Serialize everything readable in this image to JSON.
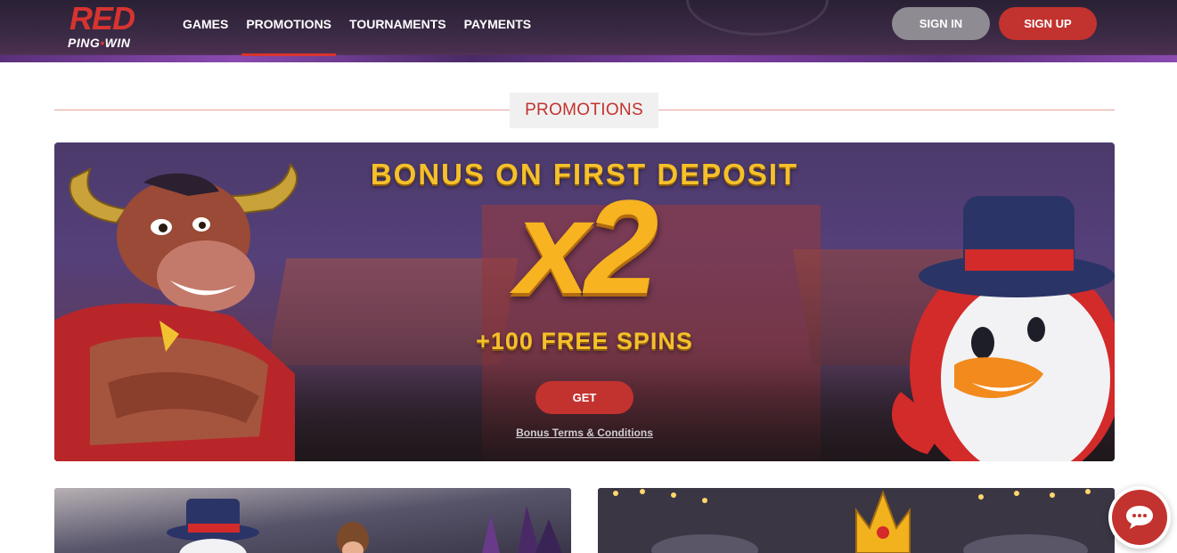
{
  "header": {
    "logo": {
      "main": "RED",
      "sub_left": "PING",
      "sub_dot": "•",
      "sub_right": "WIN"
    },
    "nav": [
      {
        "label": "GAMES",
        "active": false
      },
      {
        "label": "PROMOTIONS",
        "active": true
      },
      {
        "label": "TOURNAMENTS",
        "active": false
      },
      {
        "label": "PAYMENTS",
        "active": false
      }
    ],
    "sign_in_label": "SIGN IN",
    "sign_up_label": "SIGN UP"
  },
  "section": {
    "title": "PROMOTIONS"
  },
  "hero": {
    "heading": "BONUS ON FIRST DEPOSIT",
    "multiplier": "x2",
    "spins": "+100 FREE SPINS",
    "cta_label": "GET",
    "terms_label": "Bonus Terms & Conditions"
  },
  "cards": [
    {
      "name": "promo-card-1",
      "characters": [
        "penguin",
        "boy",
        "witch"
      ]
    },
    {
      "name": "promo-card-2",
      "characters": [
        "crown"
      ]
    }
  ],
  "chat": {
    "icon": "chat-bubble-icon"
  },
  "colors": {
    "brand_red": "#c2322e",
    "header_bg": "#2a2034",
    "gold": "#f5c02a",
    "signin_gray": "#8f8b92",
    "title_bg": "#f0f0f0"
  }
}
